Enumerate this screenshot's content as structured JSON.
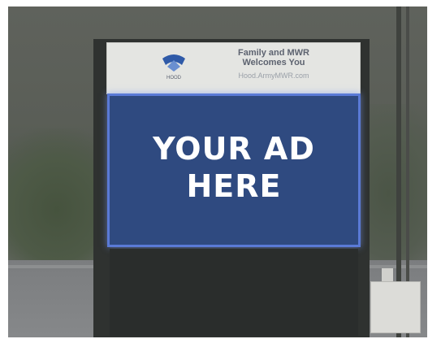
{
  "sign": {
    "header_title_line1": "Family and MWR",
    "header_title_line2": "Welcomes You",
    "header_url": "Hood.ArmyMWR.com",
    "logo_label": "HOOD",
    "ad_line1": "YOUR AD",
    "ad_line2": "HERE"
  },
  "colors": {
    "screen": "#2f4a80",
    "screen_glow": "#5a7ad6",
    "header_panel": "#e4e5e2"
  }
}
